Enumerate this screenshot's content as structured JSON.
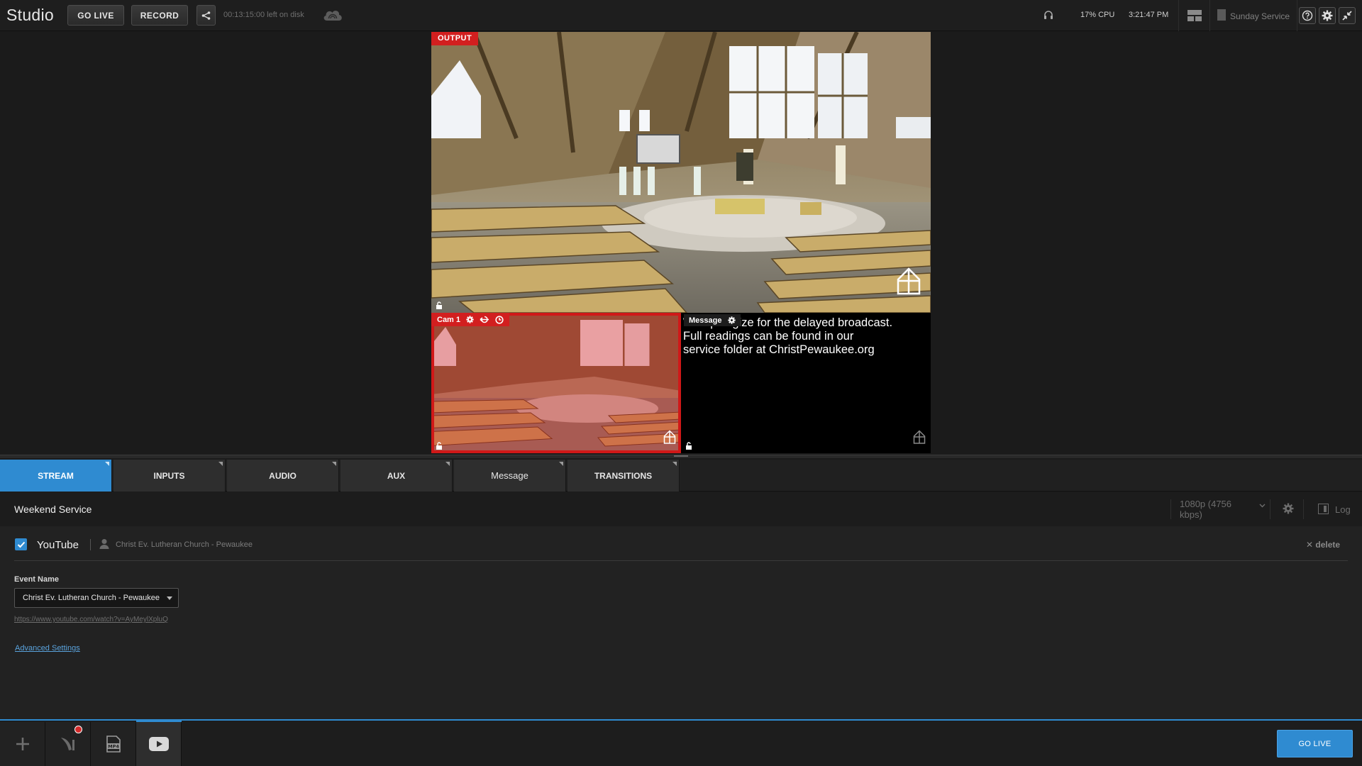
{
  "app": {
    "title": "Studio"
  },
  "topbar": {
    "go_live_label": "GO LIVE",
    "record_label": "RECORD",
    "disk_status": "00:13:15:00 left on disk",
    "cpu_usage": "17% CPU",
    "clock": "3:21:47 PM",
    "project_name": "Sunday Service",
    "icons": [
      "share-icon",
      "cloud-icon",
      "headphones-icon",
      "layout-icon",
      "document-icon",
      "help-icon",
      "gear-icon",
      "collapse-icon"
    ]
  },
  "preview": {
    "output_label": "OUTPUT",
    "sources": [
      {
        "name": "Cam 1",
        "selected": true,
        "icons": [
          "gear-icon",
          "replay-icon",
          "timer-icon"
        ]
      },
      {
        "name": "Message",
        "icons": [
          "gear-icon"
        ]
      }
    ],
    "message_text": "We apologize for the delayed broadcast.\nFull readings can be found in our\nservice folder at ChristPewaukee.org"
  },
  "tabs": [
    {
      "label": "STREAM",
      "active": true
    },
    {
      "label": "INPUTS",
      "active": false
    },
    {
      "label": "AUDIO",
      "active": false
    },
    {
      "label": "AUX",
      "active": false
    },
    {
      "label": "Message",
      "active": false
    },
    {
      "label": "TRANSITIONS",
      "active": false
    }
  ],
  "stream": {
    "broadcast_title": "Weekend Service",
    "quality": "1080p (4756 kbps)",
    "log_label": "Log",
    "destination": {
      "service": "YouTube",
      "enabled": true,
      "account": "Christ Ev. Lutheran Church - Pewaukee",
      "delete_label": "delete"
    },
    "event_name_label": "Event Name",
    "event_name_value": "Christ Ev. Lutheran Church - Pewaukee",
    "event_url": "https://www.youtube.com/watch?v=AyMeylXpluQ",
    "advanced_settings_label": "Advanced Settings"
  },
  "bottombar": {
    "items": [
      "add-icon",
      "feather-icon",
      "mp4-icon",
      "youtube-icon"
    ],
    "go_live_label": "GO LIVE"
  },
  "colors": {
    "accent": "#2f8bd1",
    "live_red": "#d21f1f",
    "background": "#1b1b1b"
  }
}
